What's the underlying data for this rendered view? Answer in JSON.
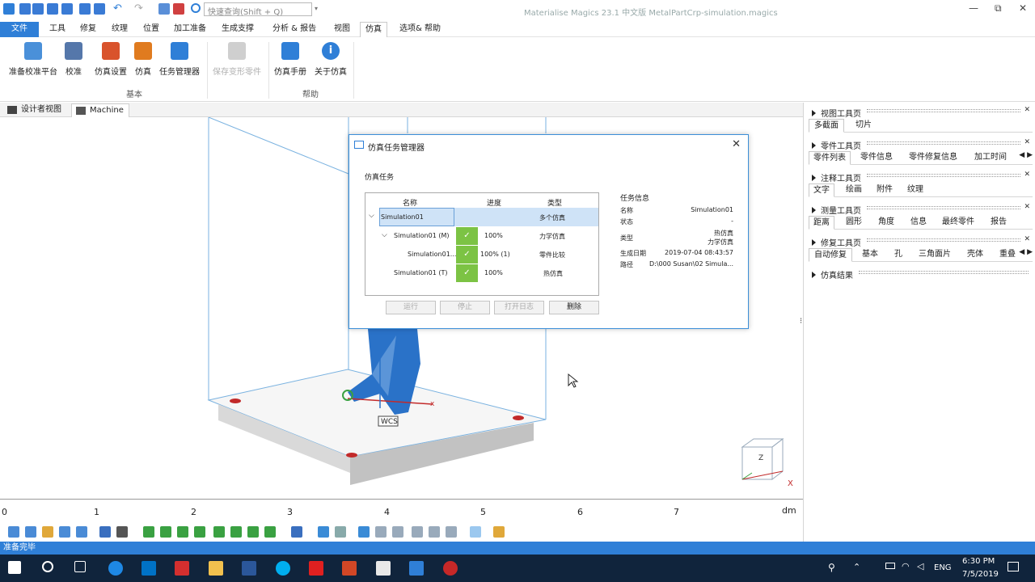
{
  "window": {
    "search_placeholder": "快速查询(Shift + Q)",
    "title": "Materialise Magics 23.1 中文版    MetalPartCrp-simulation.magics",
    "minimize": "—",
    "restore": "⧉",
    "close": "✕"
  },
  "menu": [
    "文件",
    "工具",
    "修复",
    "纹理",
    "位置",
    "加工准备",
    "生成支撑",
    "分析 & 报告",
    "视图",
    "仿真",
    "选项& 帮助"
  ],
  "ribbon": {
    "buttons": [
      {
        "label": "准备校准平台",
        "icon": "calibrate-platform-icon",
        "color": "#4a90d9"
      },
      {
        "label": "校准",
        "icon": "calibrate-icon",
        "color": "#5577aa"
      },
      {
        "label": "仿真设置",
        "icon": "simulation-settings-icon",
        "color": "#d9532c"
      },
      {
        "label": "仿真",
        "icon": "simulation-icon",
        "color": "#e07b1f"
      },
      {
        "label": "任务管理器",
        "icon": "task-manager-icon",
        "color": "#2f7fd7"
      },
      {
        "label": "保存变形零件",
        "icon": "save-deformed-part-icon",
        "color": "#c8c8c8"
      },
      {
        "label": "仿真手册",
        "icon": "simulation-manual-icon",
        "color": "#2f7fd7"
      },
      {
        "label": "关于仿真",
        "icon": "about-simulation-icon",
        "color": "#2f7fd7"
      }
    ],
    "group_basic": "基本",
    "group_help": "帮助"
  },
  "doc_tabs": [
    "设计者视图",
    "Machine"
  ],
  "ruler": {
    "ticks": [
      "0",
      "1",
      "2",
      "3",
      "4",
      "5",
      "6",
      "7"
    ],
    "unit": "dm"
  },
  "viewport": {
    "wcs_label": "WCS",
    "axis_x": "x",
    "axis_z": "Z",
    "cube_x": "X"
  },
  "status": "准备完毕",
  "taskbar": {
    "lang": "ENG",
    "time": "6:30 PM",
    "date": "7/5/2019"
  },
  "right_panel": {
    "view_toolbar": {
      "title": "视图工具页",
      "tabs": [
        "多截面",
        "切片"
      ]
    },
    "part_toolbar": {
      "title": "零件工具页",
      "tabs": [
        "零件列表",
        "零件信息",
        "零件修复信息",
        "加工时间估"
      ]
    },
    "annotation_toolbar": {
      "title": "注释工具页",
      "tabs": [
        "文字",
        "绘画",
        "附件",
        "纹理"
      ]
    },
    "measure_toolbar": {
      "title": "测量工具页",
      "tabs": [
        "距离",
        "圆形",
        "角度",
        "信息",
        "最终零件",
        "报告"
      ]
    },
    "repair_toolbar": {
      "title": "修复工具页",
      "tabs": [
        "自动修复",
        "基本",
        "孔",
        "三角面片",
        "壳体",
        "重叠"
      ]
    },
    "sim_results": {
      "title": "仿真结果"
    }
  },
  "dialog": {
    "title": "仿真任务管理器",
    "task_label": "仿真任务",
    "headers": {
      "name": "名称",
      "progress": "进度",
      "type": "类型"
    },
    "rows": [
      {
        "name": "Simulation01",
        "progress": "",
        "type": "多个仿真"
      },
      {
        "name": "Simulation01 (M)",
        "progress": "100%",
        "type": "力学仿真"
      },
      {
        "name": "Simulation01...",
        "progress": "100% (1)",
        "type": "零件比较"
      },
      {
        "name": "Simulation01 (T)",
        "progress": "100%",
        "type": "热仿真"
      }
    ],
    "info": {
      "title": "任务信息",
      "name_label": "名称",
      "name_value": "Simulation01",
      "status_label": "状态",
      "status_value": "-",
      "type_label": "类型",
      "type_value_1": "热仿真",
      "type_value_2": "力学仿真",
      "date_label": "生成日期",
      "date_value": "2019-07-04 08:43:57",
      "path_label": "路径",
      "path_value": "D:\\000 Susan\\02 Simula..."
    },
    "buttons": {
      "run": "运行",
      "stop": "停止",
      "open_log": "打开日志",
      "delete": "删除"
    },
    "close": "✕"
  }
}
